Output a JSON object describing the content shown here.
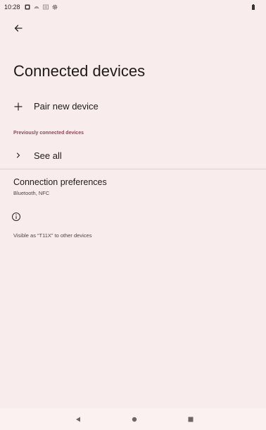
{
  "status_bar": {
    "time": "10:28",
    "icons": [
      "notification-icon",
      "vibrate-icon",
      "sim-icon",
      "settings-icon"
    ],
    "battery_icon": "battery-icon"
  },
  "header": {
    "back_icon": "back-arrow-icon",
    "title": "Connected devices"
  },
  "pair_new": {
    "icon": "plus-icon",
    "label": "Pair new device"
  },
  "previously_connected": {
    "header": "Previously connected devices",
    "see_all_icon": "chevron-right-icon",
    "see_all_label": "See all"
  },
  "connection_preferences": {
    "title": "Connection preferences",
    "summary": "Bluetooth, NFC"
  },
  "footer": {
    "info_icon": "info-icon",
    "text": "Visible as “T11X” to other devices"
  },
  "nav_bar": {
    "back_icon": "nav-back-icon",
    "home_icon": "nav-home-icon",
    "recents_icon": "nav-recents-icon"
  },
  "colors": {
    "background": "#f9ecec",
    "accent": "#8a4a57",
    "text_primary": "#1f1a1a",
    "text_secondary": "#4f4545"
  }
}
